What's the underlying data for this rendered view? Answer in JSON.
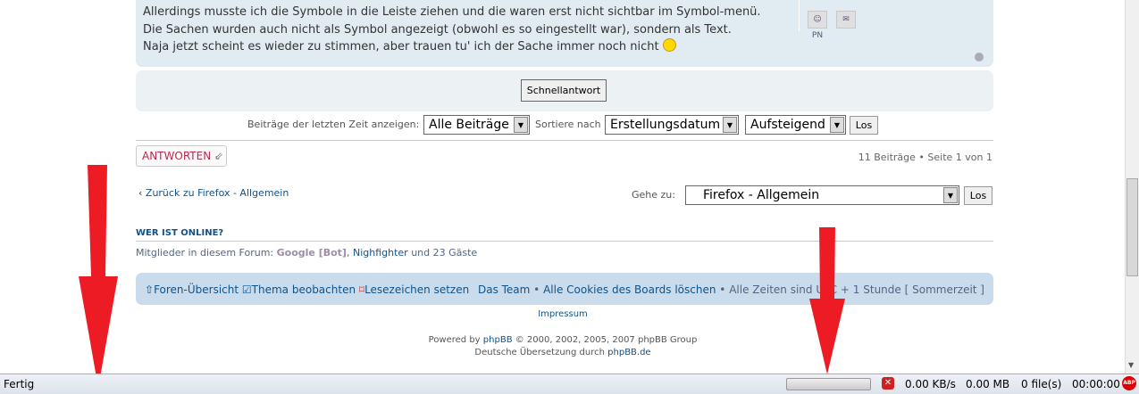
{
  "post": {
    "lines": [
      "Allerdings musste ich die Symbole in die Leiste ziehen und die waren erst nicht sichtbar im Symbol-menü.",
      "Die Sachen wurden auch nicht als Symbol angezeigt (obwohl es so eingestellt war), sondern als Text.",
      "Naja jetzt scheint es wieder zu stimmen, aber trauen tu' ich der Sache immer noch nicht"
    ],
    "pm_label": "PN"
  },
  "quick_reply": "Schnellantwort",
  "filter": {
    "label": "Beiträge der letzten Zeit anzeigen:",
    "days": "Alle Beiträge",
    "sort_label": "Sortiere nach",
    "sort_by": "Erstellungsdatum",
    "order": "Aufsteigend",
    "go": "Los"
  },
  "reply_button": "ANTWORTEN",
  "pagination": "11 Beiträge • Seite 1 von 1",
  "back_link": "Zurück zu Firefox - Allgemein",
  "jump": {
    "label": "Gehe zu:",
    "value": "Firefox - Allgemein",
    "go": "Los"
  },
  "online": {
    "title": "WER IST ONLINE?",
    "prefix": "Mitglieder in diesem Forum:",
    "bot": "Google [Bot]",
    "member": "Nighfighter",
    "suffix": "und 23 Gäste"
  },
  "navbar": {
    "index": "Foren-Übersicht",
    "watch": "Thema beobachten",
    "bookmark": "Lesezeichen setzen",
    "team": "Das Team",
    "cookies": "Alle Cookies des Boards löschen",
    "timezone": "Alle Zeiten sind UTC + 1 Stunde",
    "dst": "[ Sommerzeit ]"
  },
  "footer": {
    "impressum": "Impressum",
    "powered_prefix": "Powered by",
    "phpbb": "phpBB",
    "powered_suffix": "© 2000, 2002, 2005, 2007 phpBB Group",
    "translation_prefix": "Deutsche Übersetzung durch",
    "translation_link": "phpBB.de"
  },
  "statusbar": {
    "status": "Fertig",
    "speed": "0.00 KB/s",
    "size": "0.00 MB",
    "files": "0 file(s)",
    "time": "00:00:00",
    "abp": "ABP"
  },
  "colors": {
    "arrow": "#ed1c24",
    "post_bg": "#e1ebf2",
    "navbar_bg": "#cadceb",
    "reply_red": "#bc2a4d"
  }
}
